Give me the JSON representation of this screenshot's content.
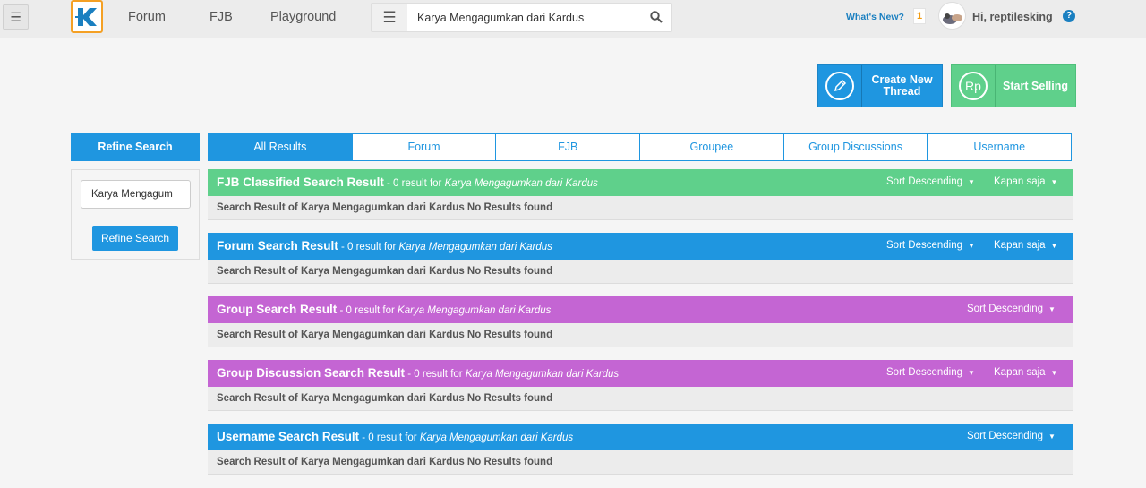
{
  "header": {
    "nav": [
      "Forum",
      "FJB",
      "Playground"
    ],
    "search_value": "Karya Mengagumkan dari Kardus",
    "whats_new": "What's New?",
    "notif_count": "1",
    "greeting": "Hi, reptilesking",
    "help": "?"
  },
  "actions": {
    "create_thread": "Create New Thread",
    "start_selling": "Start Selling",
    "rp_icon": "Rp"
  },
  "refine": {
    "title": "Refine Search",
    "input_value": "Karya Mengagum",
    "button": "Refine Search"
  },
  "tabs": [
    "All Results",
    "Forum",
    "FJB",
    "Groupee",
    "Group Discussions",
    "Username"
  ],
  "sections": [
    {
      "title": "FJB Classified Search Result",
      "sub": " - 0 result for ",
      "query": "Karya Mengagumkan dari Kardus",
      "sort": "Sort Descending",
      "when": "Kapan saja",
      "body": "Search Result of Karya Mengagumkan dari Kardus No Results found",
      "color": "#5fd08b"
    },
    {
      "title": "Forum Search Result",
      "sub": " - 0 result for ",
      "query": "Karya Mengagumkan dari Kardus",
      "sort": "Sort Descending",
      "when": "Kapan saja",
      "body": "Search Result of Karya Mengagumkan dari Kardus No Results found",
      "color": "#1f96e0"
    },
    {
      "title": "Group Search Result",
      "sub": " - 0 result for ",
      "query": "Karya Mengagumkan dari Kardus",
      "sort": "Sort Descending",
      "body": "Search Result of Karya Mengagumkan dari Kardus No Results found",
      "color": "#c465d3"
    },
    {
      "title": "Group Discussion Search Result",
      "sub": " - 0 result for ",
      "query": "Karya Mengagumkan dari Kardus",
      "sort": "Sort Descending",
      "when": "Kapan saja",
      "body": "Search Result of Karya Mengagumkan dari Kardus No Results found",
      "color": "#c465d3"
    },
    {
      "title": "Username Search Result",
      "sub": " - 0 result for ",
      "query": "Karya Mengagumkan dari Kardus",
      "sort": "Sort Descending",
      "body": "Search Result of Karya Mengagumkan dari Kardus No Results found",
      "color": "#1f96e0"
    }
  ],
  "icons": {
    "menu": "hamburger-menu-icon",
    "logo": "kaskus-logo",
    "search": "search-icon",
    "pencil": "pencil-icon",
    "caret": "caret-down-icon"
  }
}
